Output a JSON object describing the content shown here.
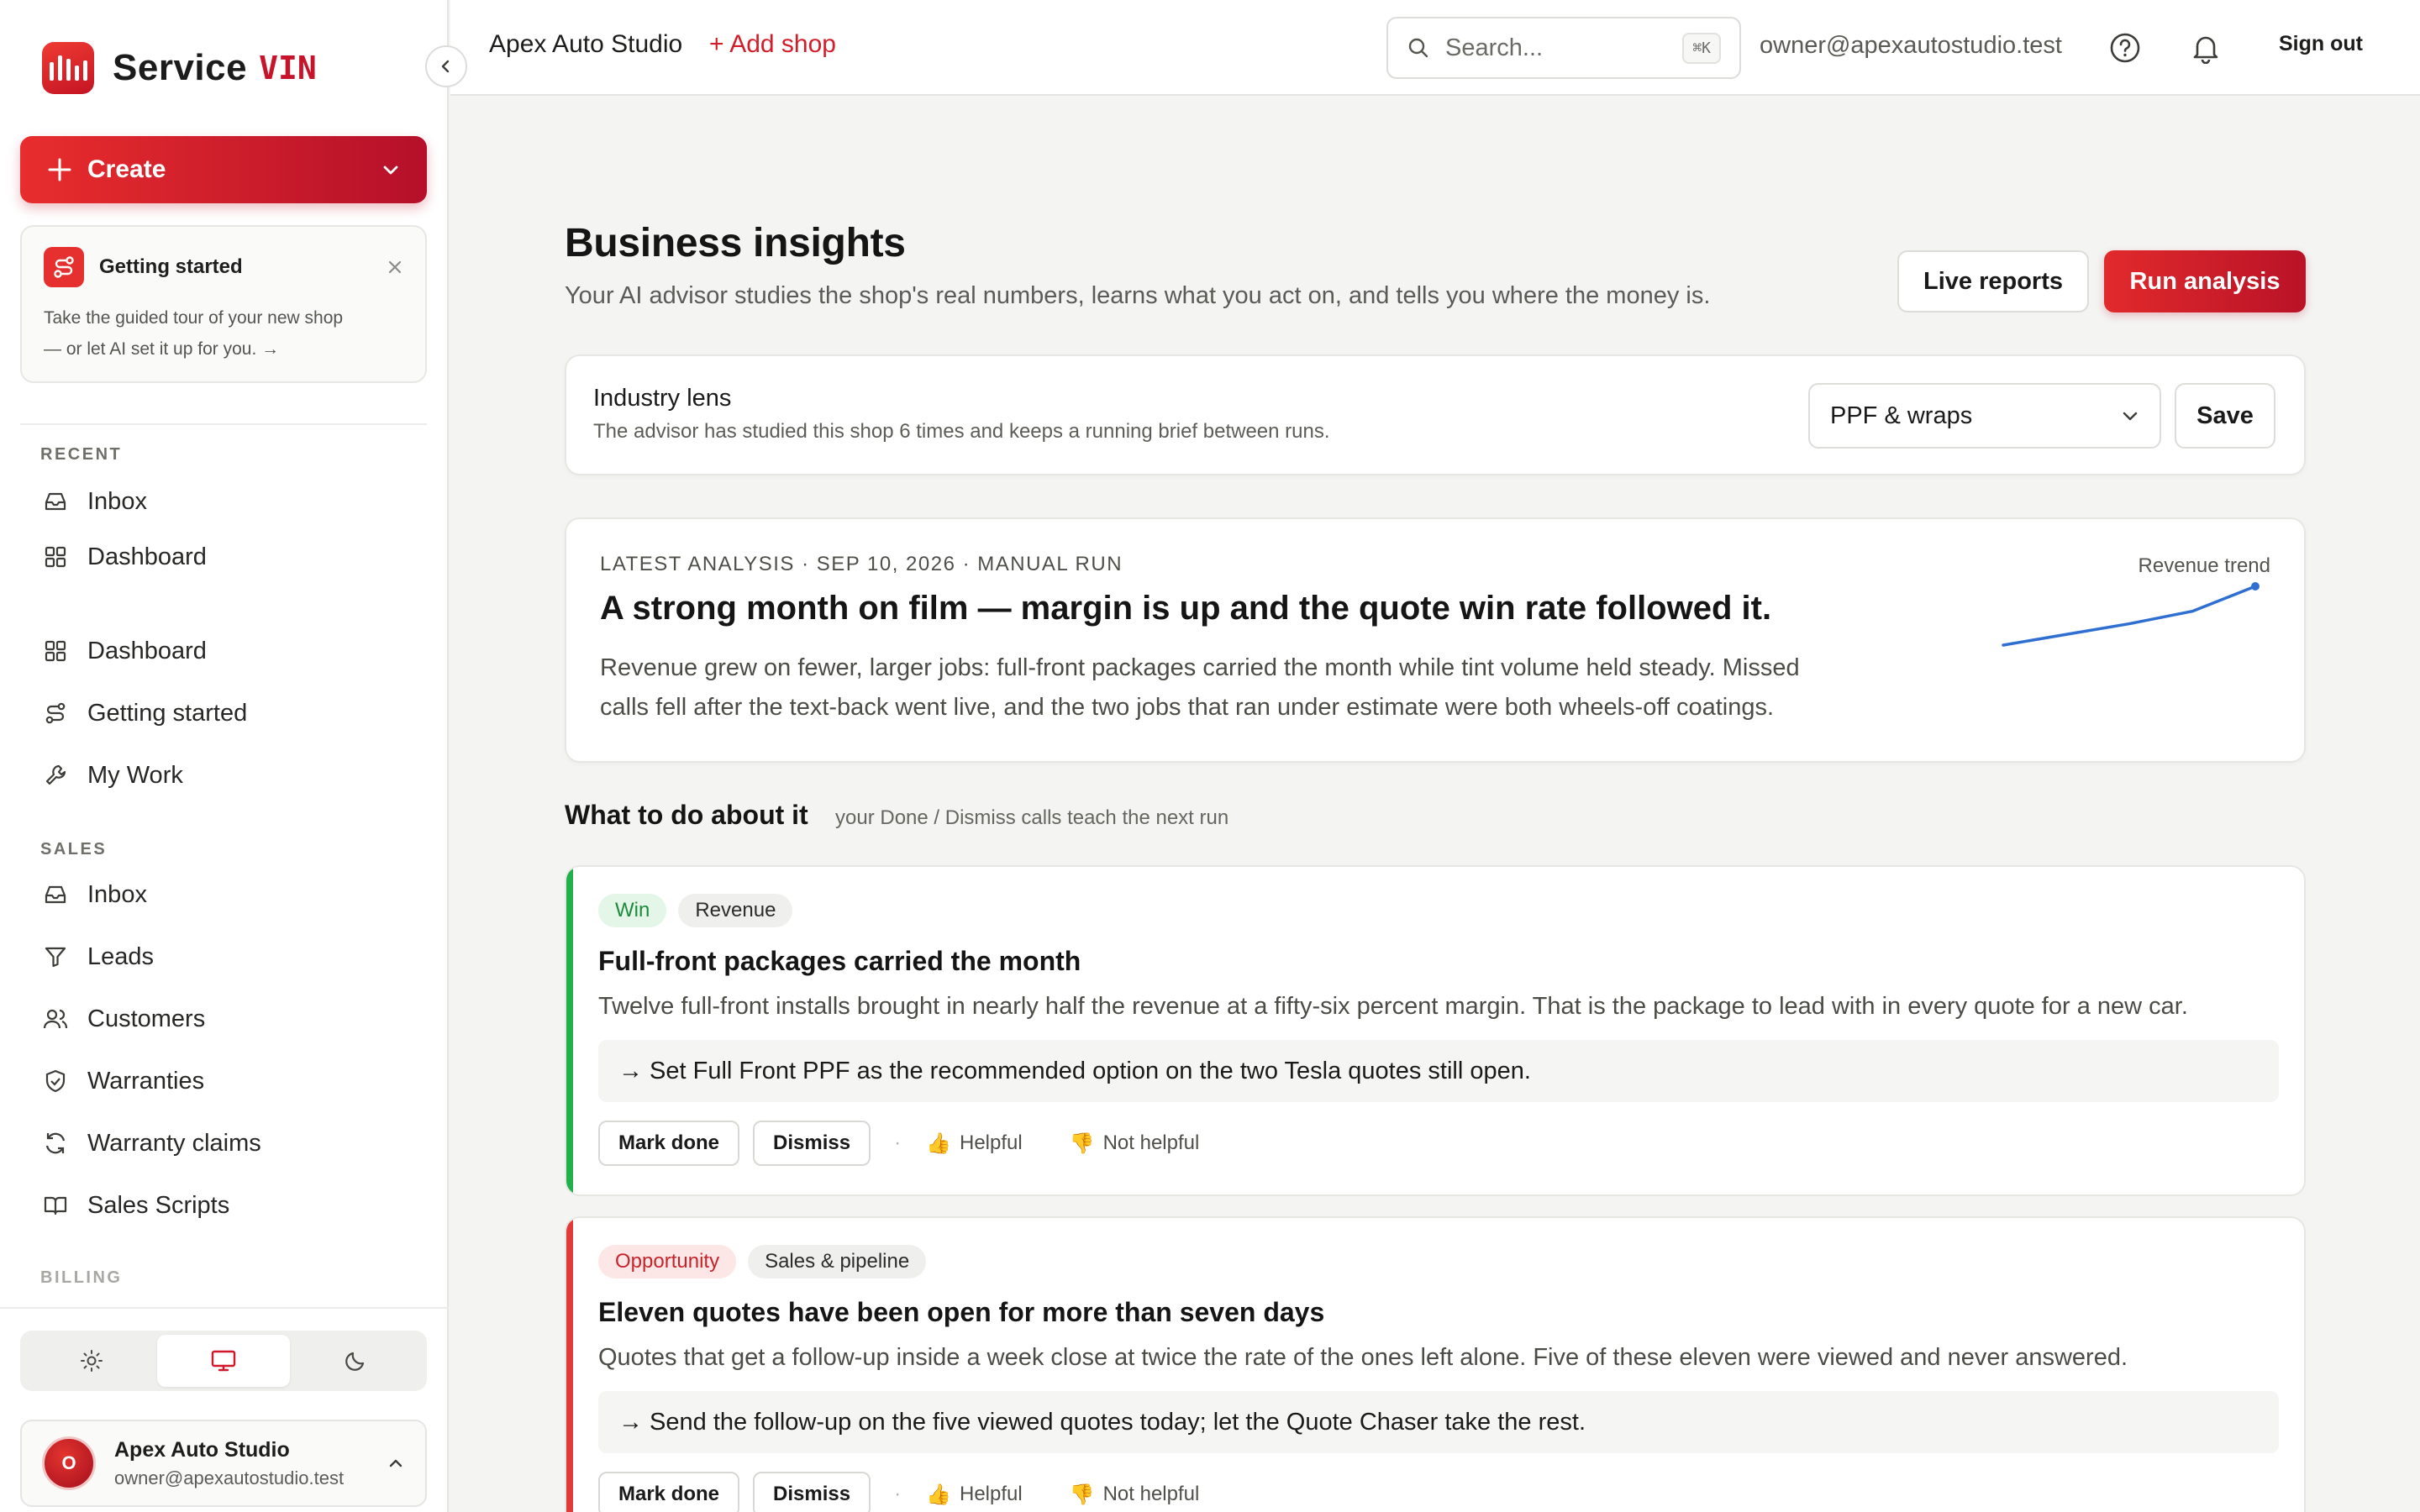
{
  "brand": {
    "name": "Service",
    "accent": "VIN"
  },
  "sidebar": {
    "create_label": "Create",
    "getting_started": {
      "title": "Getting started",
      "body_line1": "Take the guided tour of your new shop",
      "body_line2": "— or let AI set it up for you. →"
    },
    "recent_label": "RECENT",
    "recent": [
      {
        "label": "Inbox",
        "icon": "inbox-icon"
      },
      {
        "label": "Dashboard",
        "icon": "grid-icon"
      }
    ],
    "main": [
      {
        "label": "Dashboard",
        "icon": "grid-icon"
      },
      {
        "label": "Getting started",
        "icon": "route-icon"
      },
      {
        "label": "My Work",
        "icon": "wrench-icon"
      }
    ],
    "sales_label": "SALES",
    "sales": [
      {
        "label": "Inbox",
        "icon": "inbox-icon"
      },
      {
        "label": "Leads",
        "icon": "filter-icon"
      },
      {
        "label": "Customers",
        "icon": "users-icon"
      },
      {
        "label": "Warranties",
        "icon": "shield-icon"
      },
      {
        "label": "Warranty claims",
        "icon": "refresh-icon"
      },
      {
        "label": "Sales Scripts",
        "icon": "book-icon"
      }
    ],
    "billing_label": "BILLING",
    "theme": {
      "options": [
        "light",
        "system",
        "dark"
      ],
      "selected": "system"
    },
    "user": {
      "initial": "O",
      "name": "Apex Auto Studio",
      "email": "owner@apexautostudio.test"
    }
  },
  "topbar": {
    "shop_name": "Apex Auto Studio",
    "add_shop": "+ Add shop",
    "search_placeholder": "Search...",
    "search_shortcut": "⌘K",
    "email": "owner@apexautostudio.test",
    "sign_out": "Sign out"
  },
  "page": {
    "title": "Business insights",
    "subtitle": "Your AI advisor studies the shop's real numbers, learns what you act on, and tells you where the money is.",
    "live_reports": "Live reports",
    "run_analysis": "Run analysis"
  },
  "lens": {
    "title": "Industry lens",
    "subtitle": "The advisor has studied this shop 6 times and keeps a running brief between runs.",
    "selected": "PPF & wraps",
    "save": "Save"
  },
  "analysis": {
    "meta": "LATEST ANALYSIS · SEP 10, 2026 · MANUAL RUN",
    "headline": "A strong month on film — margin is up and the quote win rate followed it.",
    "body_line1": "Revenue grew on fewer, larger jobs: full-front packages carried the month while tint volume held steady. Missed",
    "body_line2": "calls fell after the text-back went live, and the two jobs that ran under estimate were both wheels-off coatings.",
    "trend_label": "Revenue trend",
    "trend_values": [
      1.0,
      1.6,
      2.2,
      2.9,
      4.3
    ],
    "trend_color": "#2f6fd1"
  },
  "todo": {
    "title": "What to do about it",
    "hint": "your Done / Dismiss calls teach the next run"
  },
  "insights": [
    {
      "tag_type": "Win",
      "tag_category": "Revenue",
      "accent_color": "#22b04b",
      "title": "Full-front packages carried the month",
      "body": "Twelve full-front installs brought in nearly half the revenue at a fifty-six percent margin. That is the package to lead with in every quote for a new car.",
      "action": "→ Set Full Front PPF as the recommended option on the two Tesla quotes still open.",
      "mark_done": "Mark done",
      "dismiss": "Dismiss",
      "helpful": "Helpful",
      "not_helpful": "Not helpful"
    },
    {
      "tag_type": "Opportunity",
      "tag_category": "Sales & pipeline",
      "accent_color": "#e23a36",
      "title": "Eleven quotes have been open for more than seven days",
      "body": "Quotes that get a follow-up inside a week close at twice the rate of the ones left alone. Five of these eleven were viewed and never answered.",
      "action": "→ Send the follow-up on the five viewed quotes today; let the Quote Chaser take the rest.",
      "mark_done": "Mark done",
      "dismiss": "Dismiss",
      "helpful": "Helpful",
      "not_helpful": "Not helpful"
    }
  ]
}
